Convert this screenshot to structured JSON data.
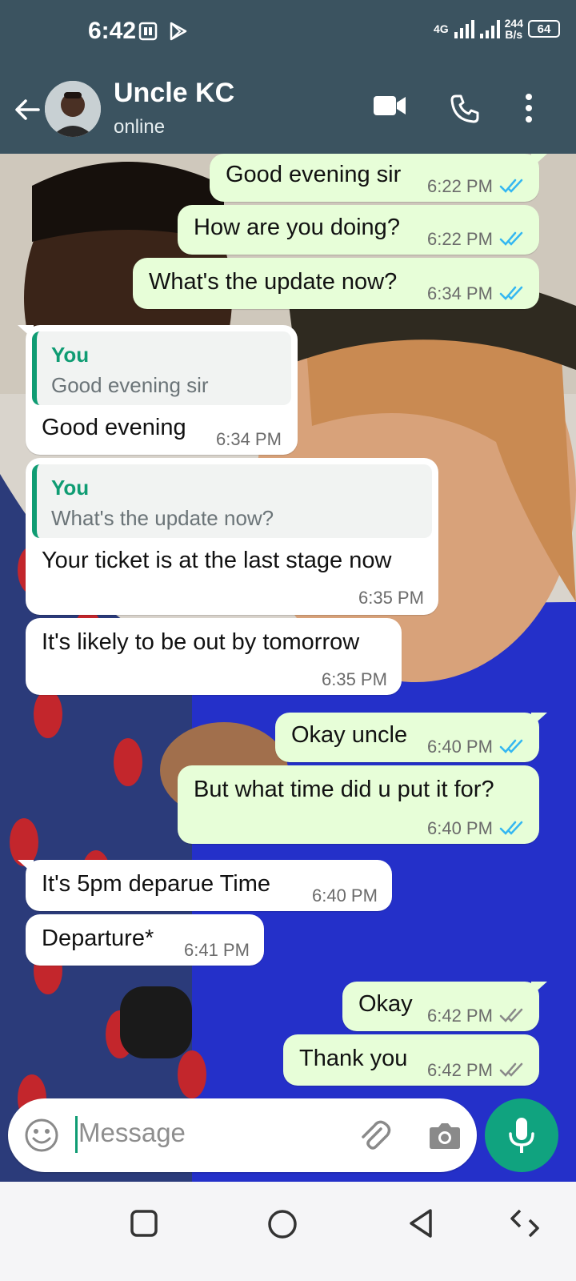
{
  "status_bar": {
    "time": "6:42",
    "network_type": "4G",
    "speed_value": "244",
    "speed_unit": "B/s",
    "battery": "64"
  },
  "header": {
    "contact_name": "Uncle KC",
    "contact_status": "online"
  },
  "messages": [
    {
      "direction": "out",
      "text": "Good evening sir",
      "time": "6:22 PM",
      "status": "read"
    },
    {
      "direction": "out",
      "text": "How are you doing?",
      "time": "6:22 PM",
      "status": "read"
    },
    {
      "direction": "out",
      "text": "What's the update now?",
      "time": "6:34 PM",
      "status": "read"
    },
    {
      "direction": "in",
      "quote_author": "You",
      "quote_text": "Good evening sir",
      "text": "Good evening",
      "time": "6:34 PM"
    },
    {
      "direction": "in",
      "quote_author": "You",
      "quote_text": "What's the update now?",
      "text": "Your ticket is at the last stage now",
      "time": "6:35 PM"
    },
    {
      "direction": "in",
      "text": "It's likely to be out by tomorrow",
      "time": "6:35 PM"
    },
    {
      "direction": "out",
      "text": "Okay uncle",
      "time": "6:40 PM",
      "status": "read"
    },
    {
      "direction": "out",
      "text": "But what time did u put it for?",
      "time": "6:40 PM",
      "status": "read"
    },
    {
      "direction": "in",
      "text": "It's 5pm deparue Time",
      "time": "6:40 PM"
    },
    {
      "direction": "in",
      "text": "Departure*",
      "time": "6:41 PM"
    },
    {
      "direction": "out",
      "text": "Okay",
      "time": "6:42 PM",
      "status": "delivered"
    },
    {
      "direction": "out",
      "text": "Thank you",
      "time": "6:42 PM",
      "status": "delivered"
    }
  ],
  "composer": {
    "placeholder": "Message"
  },
  "colors": {
    "header_bg": "#3b5360",
    "outgoing_bubble": "#e7fed8",
    "incoming_bubble": "#ffffff",
    "accent_green": "#10a37f",
    "read_tick": "#34b7f1",
    "delivered_tick": "#8a8a8a"
  }
}
